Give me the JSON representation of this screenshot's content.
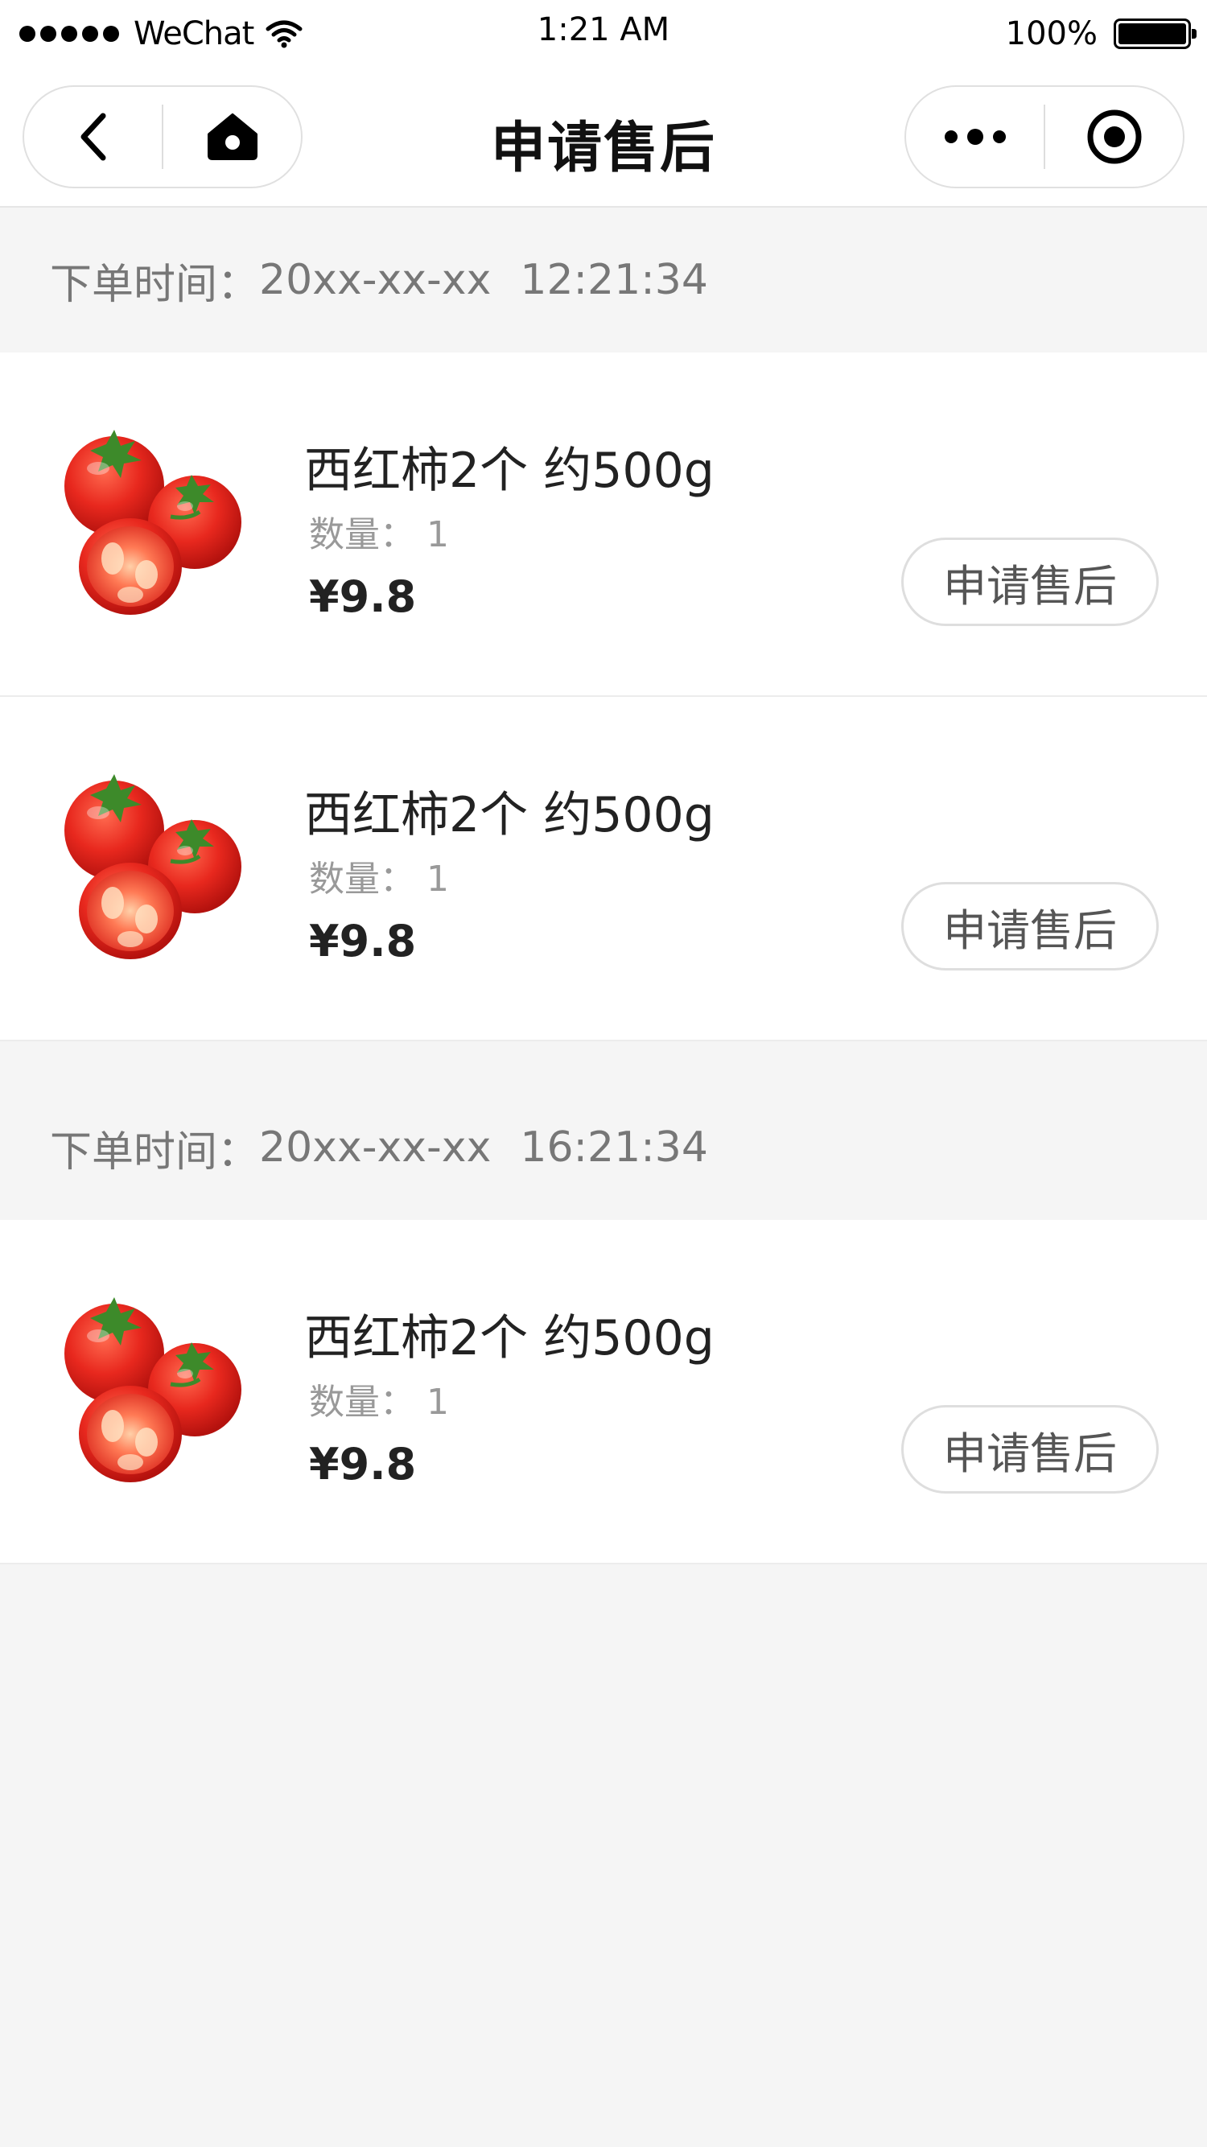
{
  "status_bar": {
    "carrier": "WeChat",
    "time": "1:21 AM",
    "battery_percent": "100%"
  },
  "nav": {
    "title": "申请售后",
    "icons": {
      "back": "back-chevron-icon",
      "home": "home-icon",
      "more": "more-dots-icon",
      "close": "target-close-icon"
    }
  },
  "orders": [
    {
      "time_label": "下单时间：",
      "date": "20xx-xx-xx",
      "time": "12:21:34",
      "items": [
        {
          "name": "西红柿2个 约500g",
          "qty": "数量： 1",
          "price": "¥9.8",
          "button": "申请售后"
        },
        {
          "name": "西红柿2个 约500g",
          "qty": "数量： 1",
          "price": "¥9.8",
          "button": "申请售后"
        }
      ]
    },
    {
      "time_label": "下单时间：",
      "date": "20xx-xx-xx",
      "time": "16:21:34",
      "items": [
        {
          "name": "西红柿2个 约500g",
          "qty": "数量： 1",
          "price": "¥9.8",
          "button": "申请售后"
        }
      ]
    }
  ],
  "colors": {
    "background": "#f5f5f5",
    "card": "#ffffff",
    "muted_text": "#999999",
    "tomato_red": "#e8281e"
  }
}
